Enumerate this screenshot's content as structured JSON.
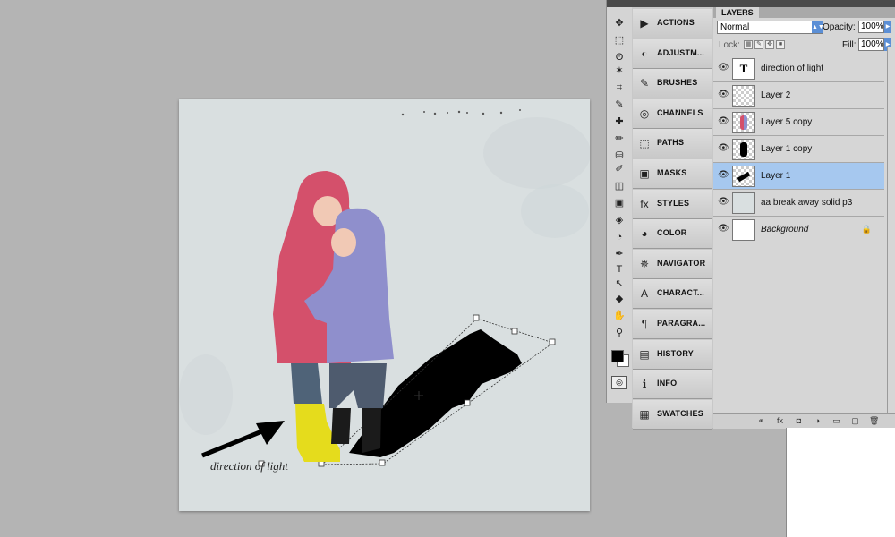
{
  "canvas": {
    "caption": "direction of light",
    "colors": {
      "paper": "#d9dfe0",
      "coat_pink": "#d4506b",
      "coat_purple": "#8f8fcc",
      "boots": "#e5dc1c",
      "shadow": "#000000"
    }
  },
  "tools": {
    "icons": [
      "move-icon",
      "marquee-icon",
      "lasso-icon",
      "magic-wand-icon",
      "crop-icon",
      "eyedropper-icon",
      "healing-icon",
      "brush-icon",
      "clone-stamp-icon",
      "history-brush-icon",
      "eraser-icon",
      "gradient-icon",
      "blur-icon",
      "dodge-icon",
      "pen-icon",
      "type-icon",
      "path-select-icon",
      "shape-icon",
      "hand-icon",
      "zoom-icon"
    ],
    "glyphs": [
      "✥",
      "⬚",
      "ʘ",
      "✶",
      "⌗",
      "✎",
      "✚",
      "✏",
      "⛁",
      "✐",
      "◫",
      "▣",
      "◈",
      "◔",
      "✒",
      "T",
      "↖",
      "◆",
      "✋",
      "⚲"
    ],
    "foreground_color": "#000000",
    "background_color": "#ffffff"
  },
  "dock": {
    "items": [
      {
        "label": "ACTIONS",
        "icon": "actions-icon",
        "glyph": "▶"
      },
      {
        "label": "ADJUSTM...",
        "icon": "adjustments-icon",
        "glyph": "◐"
      },
      {
        "label": "BRUSHES",
        "icon": "brushes-icon",
        "glyph": "✎"
      },
      {
        "label": "CHANNELS",
        "icon": "channels-icon",
        "glyph": "◎"
      },
      {
        "label": "PATHS",
        "icon": "paths-icon",
        "glyph": "⬚"
      },
      {
        "label": "MASKS",
        "icon": "masks-icon",
        "glyph": "▣"
      },
      {
        "label": "STYLES",
        "icon": "styles-icon",
        "glyph": "fx"
      },
      {
        "label": "COLOR",
        "icon": "color-icon",
        "glyph": "◕"
      },
      {
        "label": "NAVIGATOR",
        "icon": "navigator-icon",
        "glyph": "✵"
      },
      {
        "label": "CHARACT...",
        "icon": "character-icon",
        "glyph": "A"
      },
      {
        "label": "PARAGRA...",
        "icon": "paragraph-icon",
        "glyph": "¶"
      },
      {
        "label": "HISTORY",
        "icon": "history-icon",
        "glyph": "▤"
      },
      {
        "label": "INFO",
        "icon": "info-icon",
        "glyph": "ℹ"
      },
      {
        "label": "SWATCHES",
        "icon": "swatches-icon",
        "glyph": "▦"
      }
    ]
  },
  "layers_panel": {
    "tab": "LAYERS",
    "blend_mode": "Normal",
    "opacity_label": "Opacity:",
    "opacity_value": "100%",
    "lock_label": "Lock:",
    "fill_label": "Fill:",
    "fill_value": "100%",
    "selected_color": "#a6c8ef",
    "layers": [
      {
        "name": "direction of light",
        "thumb": "type",
        "italic": false,
        "selected": false,
        "locked": false
      },
      {
        "name": "Layer 2",
        "thumb": "transparent",
        "italic": false,
        "selected": false,
        "locked": false
      },
      {
        "name": "Layer 5 copy",
        "thumb": "kids",
        "italic": false,
        "selected": false,
        "locked": false
      },
      {
        "name": "Layer 1 copy",
        "thumb": "silhouette",
        "italic": false,
        "selected": false,
        "locked": false
      },
      {
        "name": "Layer 1",
        "thumb": "shadow",
        "italic": false,
        "selected": true,
        "locked": false
      },
      {
        "name": "aa break away solid p3",
        "thumb": "paper",
        "italic": false,
        "selected": false,
        "locked": false
      },
      {
        "name": "Background",
        "thumb": "white",
        "italic": true,
        "selected": false,
        "locked": true
      }
    ],
    "footer_icons": [
      "link-icon",
      "fx-icon",
      "mask-icon",
      "adjustment-icon",
      "group-icon",
      "new-layer-icon",
      "trash-icon"
    ],
    "footer_glyphs": [
      "⚭",
      "fx",
      "◘",
      "◑",
      "▭",
      "▢",
      "🗑"
    ]
  }
}
